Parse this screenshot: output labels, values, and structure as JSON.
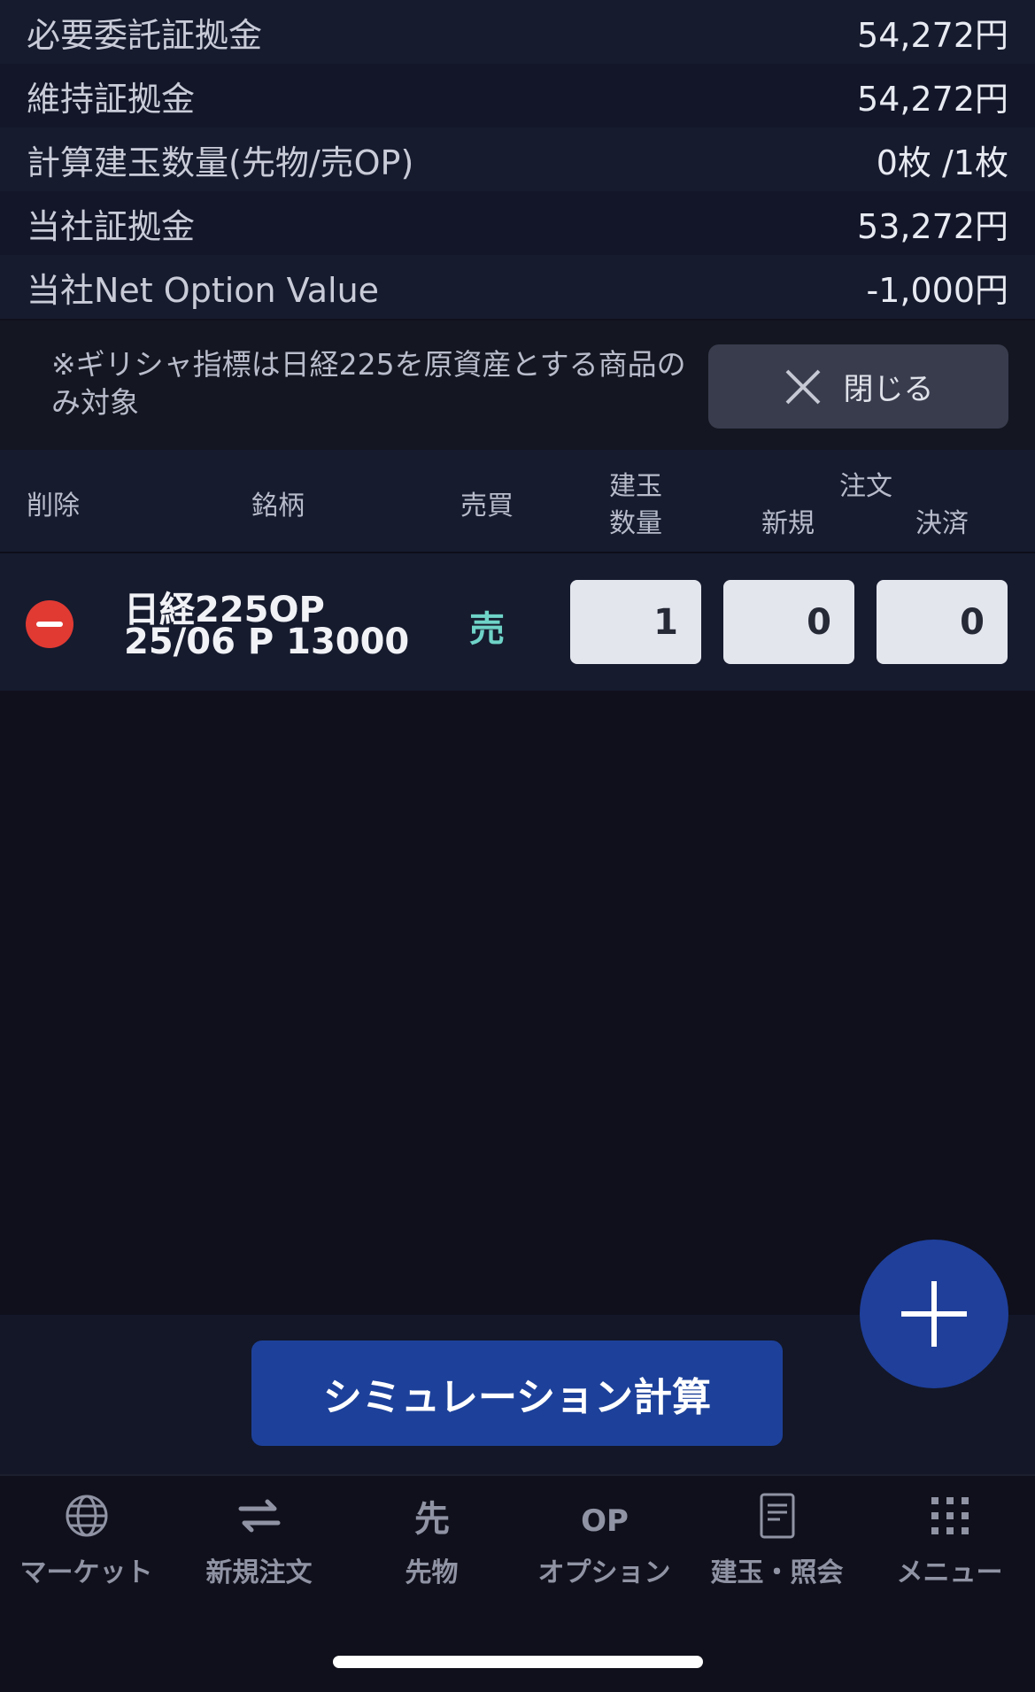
{
  "summary": [
    {
      "label": "必要委託証拠金",
      "value": "54,272円"
    },
    {
      "label": "維持証拠金",
      "value": "54,272円"
    },
    {
      "label": "計算建玉数量(先物/売OP)",
      "value": "0枚 /1枚"
    },
    {
      "label": "当社証拠金",
      "value": "53,272円"
    },
    {
      "label": "当社Net Option Value",
      "value": "-1,000円"
    }
  ],
  "note": "※ギリシャ指標は日経225を原資産とする商品のみ対象",
  "close_label": "閉じる",
  "table": {
    "headers": {
      "delete": "削除",
      "symbol": "銘柄",
      "side": "売買",
      "position_l1": "建玉",
      "position_l2": "数量",
      "order": "注文",
      "new": "新規",
      "settle": "決済"
    },
    "row": {
      "name_line1": "日経225OP",
      "name_line2": "25/06 P 13000",
      "side": "売",
      "position_qty": "1",
      "new_qty": "0",
      "settle_qty": "0"
    }
  },
  "simulate_label": "シミュレーション計算",
  "tabs": [
    {
      "label": "マーケット",
      "icon": "globe-icon"
    },
    {
      "label": "新規注文",
      "icon": "exchange-arrows-icon"
    },
    {
      "label": "先物",
      "icon": "futures-icon"
    },
    {
      "label": "オプション",
      "icon": "option-op-icon"
    },
    {
      "label": "建玉・照会",
      "icon": "document-icon"
    },
    {
      "label": "メニュー",
      "icon": "grid-menu-icon"
    }
  ],
  "colors": {
    "background": "#10101c",
    "row": "#161b2e",
    "accent": "#1d419a",
    "sell": "#6fd3c8",
    "delete": "#e03a33"
  }
}
